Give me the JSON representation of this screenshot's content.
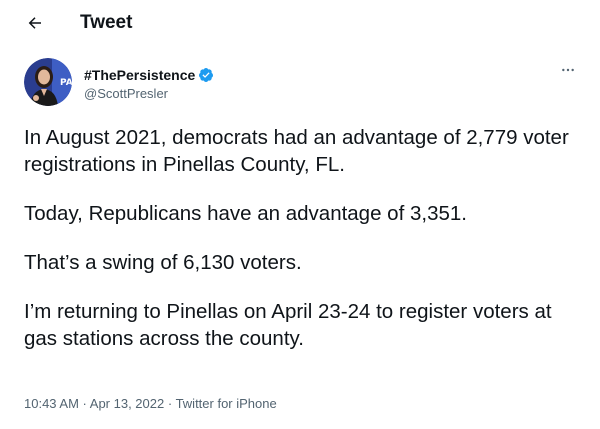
{
  "header": {
    "title": "Tweet"
  },
  "author": {
    "display_name": "#ThePersistence",
    "handle": "@ScottPresler",
    "verified": true
  },
  "tweet": {
    "paragraphs": [
      "In August 2021, democrats had an advantage of 2,779 voter registrations in Pinellas County, FL.",
      "Today, Republicans have an advantage of 3,351.",
      "That’s a swing of 6,130 voters.",
      "I’m returning to Pinellas on April 23-24 to register voters at gas stations across the county."
    ]
  },
  "meta": {
    "time": "10:43 AM",
    "date": "Apr 13, 2022",
    "separator": " · ",
    "source": "Twitter for iPhone"
  },
  "icons": {
    "back": "arrow-left-icon",
    "verified": "verified-badge-icon",
    "more": "more-options-icon"
  },
  "colors": {
    "text_primary": "#0f1419",
    "text_secondary": "#536471",
    "verified_blue": "#1d9bf0"
  }
}
